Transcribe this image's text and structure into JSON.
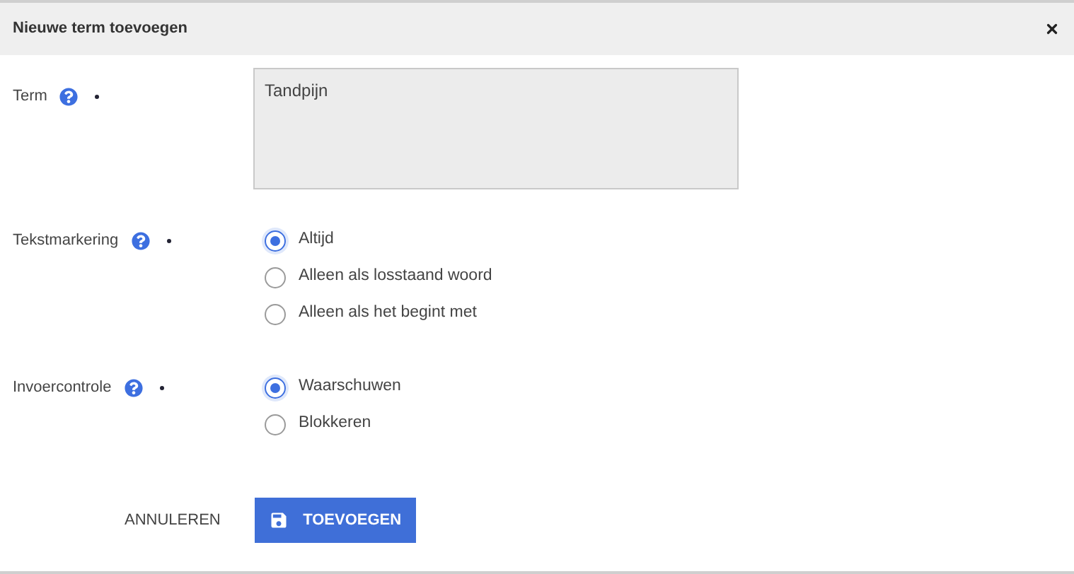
{
  "dialog": {
    "title": "Nieuwe term toevoegen"
  },
  "fields": [
    {
      "kind": "textarea",
      "label": "Term",
      "required": true,
      "value": "Tandpijn"
    },
    {
      "kind": "radio",
      "label": "Tekstmarkering",
      "required": true,
      "options": [
        {
          "label": "Altijd",
          "selected": true
        },
        {
          "label": "Alleen als losstaand woord",
          "selected": false
        },
        {
          "label": "Alleen als het begint met",
          "selected": false
        }
      ]
    },
    {
      "kind": "radio",
      "label": "Invoercontrole",
      "required": true,
      "options": [
        {
          "label": "Waarschuwen",
          "selected": true
        },
        {
          "label": "Blokkeren",
          "selected": false
        }
      ]
    }
  ],
  "buttons": {
    "cancel": "ANNULEREN",
    "submit": "TOEVOEGEN"
  }
}
